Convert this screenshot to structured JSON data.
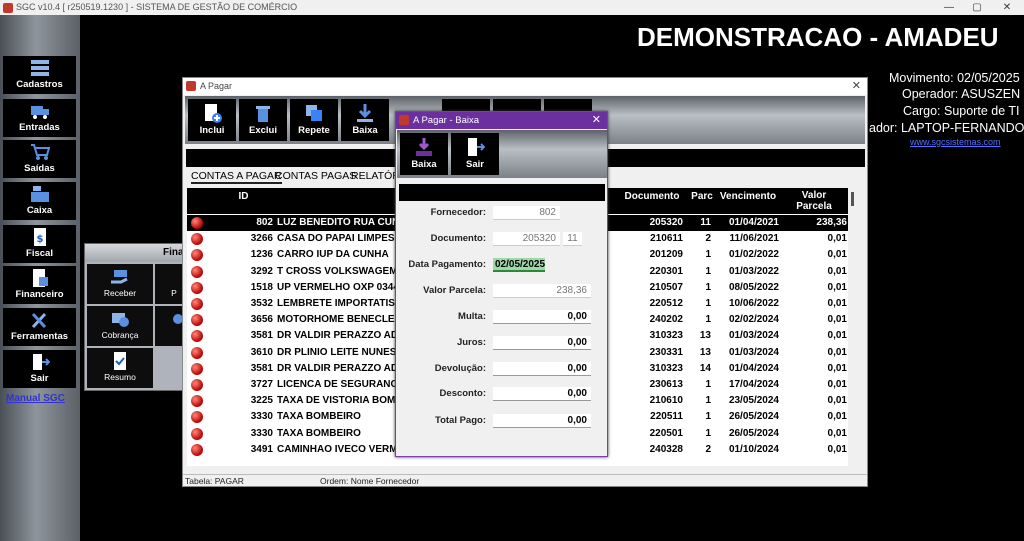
{
  "app_titlebar": "SGC v10.4 [ r250519.1230 ] - SISTEMA DE GESTÃO DE COMÉRCIO",
  "window_controls": {
    "minimize": "—",
    "maximize": "▢",
    "close": "✕"
  },
  "sidebar": {
    "items": [
      {
        "label": "Cadastros",
        "icon": "grid-icon"
      },
      {
        "label": "Entradas",
        "icon": "truck-icon"
      },
      {
        "label": "Saídas",
        "icon": "cart-icon"
      },
      {
        "label": "Caixa",
        "icon": "cash-register-icon"
      },
      {
        "label": "Fiscal",
        "icon": "document-dollar-icon"
      },
      {
        "label": "Financeiro",
        "icon": "document-chart-icon"
      },
      {
        "label": "Ferramentas",
        "icon": "tools-icon"
      },
      {
        "label": "Sair",
        "icon": "exit-door-icon"
      }
    ],
    "manual_link": "Manual SGC"
  },
  "header": {
    "company": "DEMONSTRACAO - AMADEU",
    "movimento": "Movimento: 02/05/2025",
    "operador": "Operador: ASUSZEN",
    "cargo": "Cargo: Suporte de TI",
    "computador": "ador: LAPTOP-FERNANDO",
    "website": "www.sgcsistemas.com"
  },
  "financeiro_panel": {
    "title": "Fina",
    "buttons": [
      {
        "label": "Receber"
      },
      {
        "label": "P"
      },
      {
        "label": "Cobrança"
      },
      {
        "label": ""
      },
      {
        "label": "Resumo"
      }
    ]
  },
  "apagar_window": {
    "title": "A Pagar",
    "close": "✕",
    "toolbar": [
      {
        "label": "Inclui"
      },
      {
        "label": "Exclui"
      },
      {
        "label": "Repete"
      },
      {
        "label": "Baixa"
      }
    ],
    "tabs": [
      "CONTAS A PAGAR",
      "CONTAS PAGAS",
      "RELATÓR"
    ],
    "columns": {
      "id": "ID",
      "documento": "Documento",
      "parc": "Parc",
      "vencimento": "Vencimento",
      "valor_1": "Valor",
      "valor_2": "Parcela"
    },
    "rows": [
      {
        "id": "802",
        "nome": "LUZ BENEDITO RUA CUN",
        "doc": "205320",
        "parc": "11",
        "venc": "01/04/2021",
        "valor": "238,36"
      },
      {
        "id": "3266",
        "nome": "CASA DO PAPAI LIMPESA",
        "doc": "210611",
        "parc": "2",
        "venc": "11/06/2021",
        "valor": "0,01"
      },
      {
        "id": "1236",
        "nome": "CARRO IUP DA CUNHA",
        "doc": "201209",
        "parc": "1",
        "venc": "01/02/2022",
        "valor": "0,01"
      },
      {
        "id": "3292",
        "nome": "T CROSS VOLKSWAGEM",
        "doc": "220301",
        "parc": "1",
        "venc": "01/03/2022",
        "valor": "0,01"
      },
      {
        "id": "1518",
        "nome": "UP VERMELHO OXP 0344",
        "doc": "210507",
        "parc": "1",
        "venc": "08/05/2022",
        "valor": "0,01"
      },
      {
        "id": "3532",
        "nome": "LEMBRETE IMPORTATIS",
        "doc": "220512",
        "parc": "1",
        "venc": "10/06/2022",
        "valor": "0,01"
      },
      {
        "id": "3656",
        "nome": "MOTORHOME BENECLE",
        "doc": "240202",
        "parc": "1",
        "venc": "02/02/2024",
        "valor": "0,01"
      },
      {
        "id": "3581",
        "nome": "DR VALDIR PERAZZO ADV",
        "doc": "310323",
        "parc": "13",
        "venc": "01/03/2024",
        "valor": "0,01"
      },
      {
        "id": "3610",
        "nome": "DR PLINIO LEITE NUNES",
        "doc": "230331",
        "parc": "13",
        "venc": "01/03/2024",
        "valor": "0,01"
      },
      {
        "id": "3581",
        "nome": "DR VALDIR PERAZZO ADV",
        "doc": "310323",
        "parc": "14",
        "venc": "01/04/2024",
        "valor": "0,01"
      },
      {
        "id": "3727",
        "nome": "LICENCA DE SEGURANC",
        "doc": "230613",
        "parc": "1",
        "venc": "17/04/2024",
        "valor": "0,01"
      },
      {
        "id": "3225",
        "nome": "TAXA DE VISTORIA BOME",
        "doc": "210610",
        "parc": "1",
        "venc": "23/05/2024",
        "valor": "0,01"
      },
      {
        "id": "3330",
        "nome": "TAXA BOMBEIRO",
        "doc": "220511",
        "parc": "1",
        "venc": "26/05/2024",
        "valor": "0,01"
      },
      {
        "id": "3330",
        "nome": "TAXA BOMBEIRO",
        "doc": "220501",
        "parc": "1",
        "venc": "26/05/2024",
        "valor": "0,01"
      },
      {
        "id": "3491",
        "nome": "CAMINHAO IVECO VERM",
        "doc": "240328",
        "parc": "2",
        "venc": "01/10/2024",
        "valor": "0,01"
      }
    ],
    "status": {
      "tabela": "Tabela: PAGAR",
      "ordem": "Ordem: Nome Fornecedor"
    }
  },
  "baixa_dialog": {
    "title": "A Pagar - Baixa",
    "close": "✕",
    "toolbar": [
      {
        "label": "Baixa"
      },
      {
        "label": "Sair"
      }
    ],
    "fields": {
      "fornecedor_label": "Fornecedor:",
      "fornecedor_value": "802",
      "documento_label": "Documento:",
      "documento_value": "205320",
      "parcela_value": "11",
      "data_label": "Data Pagamento:",
      "data_value": "02/05/2025",
      "valor_label": "Valor Parcela:",
      "valor_value": "238,36",
      "multa_label": "Multa:",
      "multa_value": "0,00",
      "juros_label": "Juros:",
      "juros_value": "0,00",
      "devolucao_label": "Devolução:",
      "devolucao_value": "0,00",
      "desconto_label": "Desconto:",
      "desconto_value": "0,00",
      "total_label": "Total Pago:",
      "total_value": "0,00"
    }
  }
}
